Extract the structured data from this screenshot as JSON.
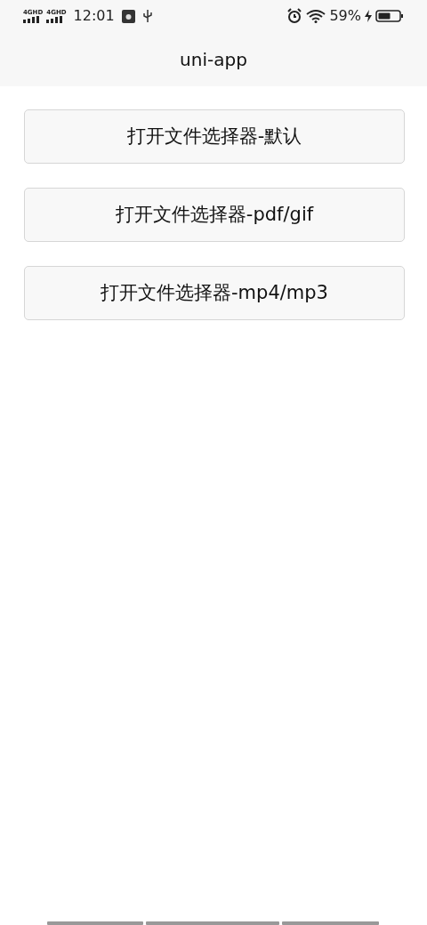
{
  "status_bar": {
    "networks": [
      "4GHD",
      "4GHD"
    ],
    "time": "12:01",
    "battery": "59%",
    "charging": true
  },
  "navigation_bar": {
    "title": "uni-app"
  },
  "buttons": [
    {
      "label": "打开文件选择器-默认"
    },
    {
      "label": "打开文件选择器-pdf/gif"
    },
    {
      "label": "打开文件选择器-mp4/mp3"
    }
  ]
}
